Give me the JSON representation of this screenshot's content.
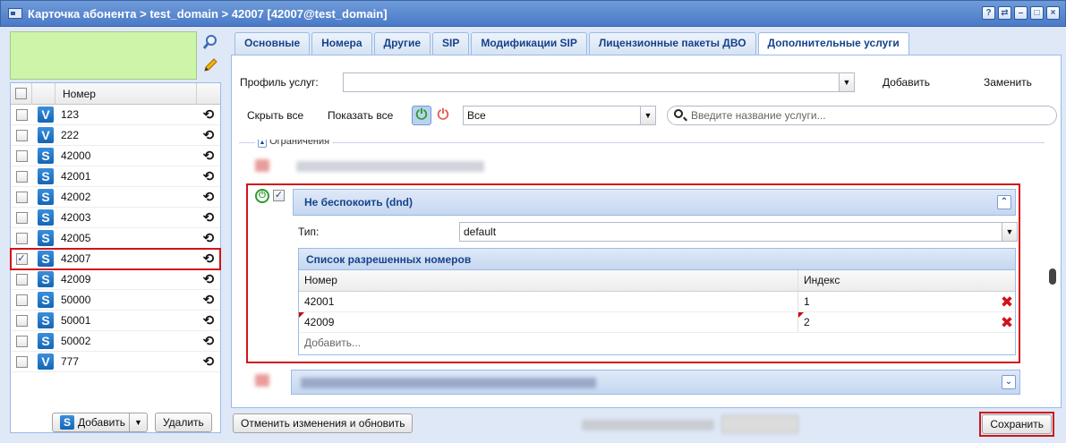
{
  "window": {
    "title": "Карточка абонента > test_domain > 42007 [42007@test_domain]"
  },
  "left": {
    "column_header": "Номер",
    "rows": [
      {
        "type": "V",
        "number": "123",
        "checked": false
      },
      {
        "type": "V",
        "number": "222",
        "checked": false
      },
      {
        "type": "S",
        "number": "42000",
        "checked": false
      },
      {
        "type": "S",
        "number": "42001",
        "checked": false
      },
      {
        "type": "S",
        "number": "42002",
        "checked": false
      },
      {
        "type": "S",
        "number": "42003",
        "checked": false
      },
      {
        "type": "S",
        "number": "42005",
        "checked": false
      },
      {
        "type": "S",
        "number": "42007",
        "checked": true
      },
      {
        "type": "S",
        "number": "42009",
        "checked": false
      },
      {
        "type": "S",
        "number": "50000",
        "checked": false
      },
      {
        "type": "S",
        "number": "50001",
        "checked": false
      },
      {
        "type": "S",
        "number": "50002",
        "checked": false
      },
      {
        "type": "V",
        "number": "777",
        "checked": false
      }
    ],
    "add_label": "Добавить",
    "delete_label": "Удалить"
  },
  "tabs": [
    "Основные",
    "Номера",
    "Другие",
    "SIP",
    "Модификации SIP",
    "Лицензионные пакеты ДВО",
    "Дополнительные услуги"
  ],
  "active_tab": "Дополнительные услуги",
  "profile": {
    "label": "Профиль услуг:",
    "value": "",
    "add_label": "Добавить",
    "replace_label": "Заменить"
  },
  "toolbar": {
    "hide_all": "Скрыть все",
    "show_all": "Показать все",
    "filter_value": "Все",
    "search_placeholder": "Введите название услуги..."
  },
  "section_legend": "Ограничения",
  "dnd": {
    "title": "Не беспокоить (dnd)",
    "type_label": "Тип:",
    "type_value": "default",
    "list_title": "Список разрешенных номеров",
    "col_number": "Номер",
    "col_index": "Индекс",
    "rows": [
      {
        "number": "42001",
        "index": "1"
      },
      {
        "number": "42009",
        "index": "2"
      }
    ],
    "add_placeholder": "Добавить..."
  },
  "footer": {
    "cancel_label": "Отменить изменения и обновить",
    "save_label": "Сохранить"
  },
  "colors": {
    "highlight": "#d0141a",
    "accent": "#15428b",
    "green_box": "#ccf5a8"
  }
}
